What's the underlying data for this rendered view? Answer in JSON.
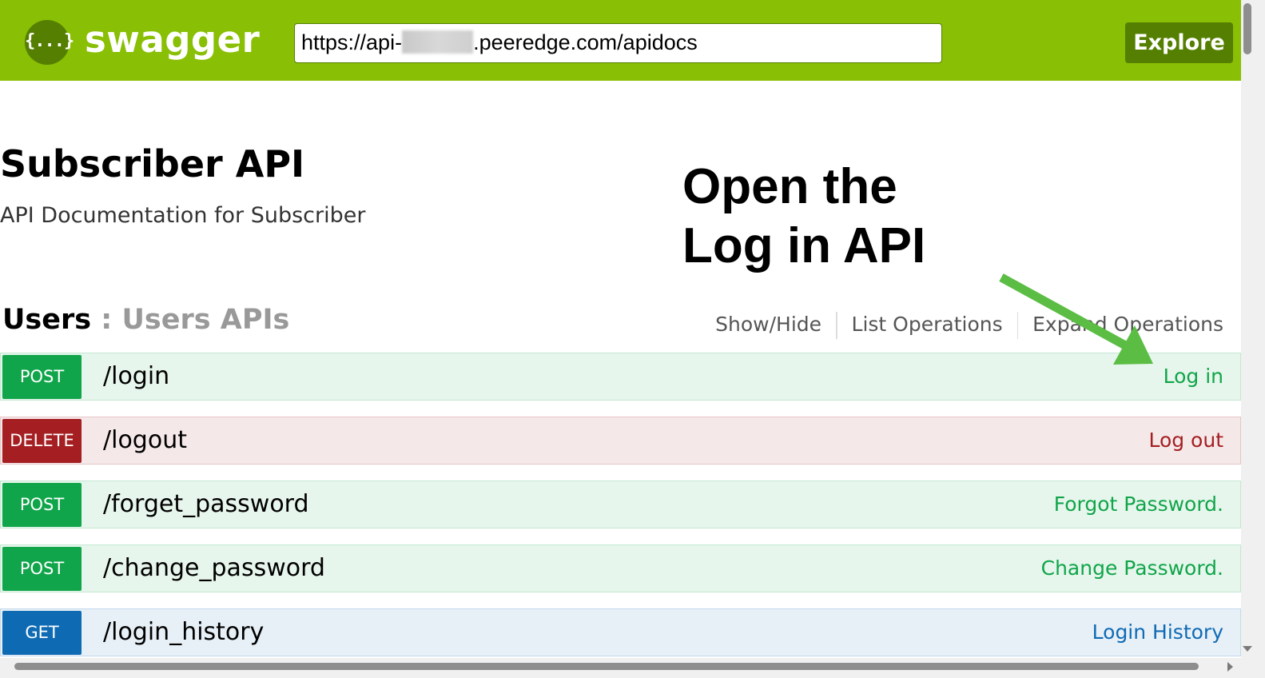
{
  "header": {
    "brand": "swagger",
    "logo_glyph": "{...}",
    "url_prefix": "https://api-",
    "url_suffix": ".peeredge.com/apidocs",
    "explore_label": "Explore"
  },
  "info": {
    "title": "Subscriber API",
    "description": "API Documentation for Subscriber"
  },
  "annotation": {
    "lines": [
      "Open the",
      "Log in API"
    ],
    "arrow_color": "#5bbd44"
  },
  "resource": {
    "name": "Users",
    "separator": " : ",
    "description": "Users APIs",
    "actions": [
      "Show/Hide",
      "List Operations",
      "Expand Operations"
    ]
  },
  "operations": [
    {
      "method": "POST",
      "path": "/login",
      "summary": "Log in"
    },
    {
      "method": "DELETE",
      "path": "/logout",
      "summary": "Log out"
    },
    {
      "method": "POST",
      "path": "/forget_password",
      "summary": "Forgot Password."
    },
    {
      "method": "POST",
      "path": "/change_password",
      "summary": "Change Password."
    },
    {
      "method": "GET",
      "path": "/login_history",
      "summary": "Login History"
    }
  ],
  "colors": {
    "header_bg": "#89bf04",
    "header_dark": "#547f00",
    "post": "#10a54a",
    "delete": "#a41e22",
    "get": "#0f6ab4"
  }
}
